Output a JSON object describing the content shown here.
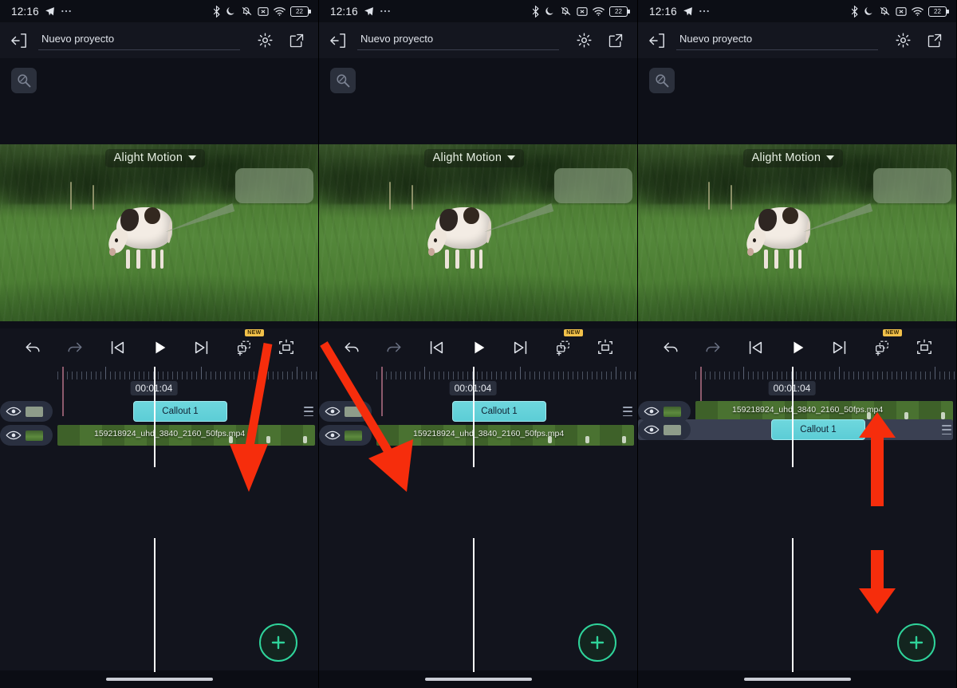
{
  "status_bar": {
    "time": "12:16",
    "left_icons": [
      "telegram-send-icon",
      "more-dots-icon"
    ],
    "right_icons": [
      "bluetooth-icon",
      "do-not-disturb-moon-icon",
      "bell-muted-icon",
      "x-box-icon",
      "wifi-icon"
    ],
    "battery_level": "22"
  },
  "header": {
    "back_label": "back-arrow",
    "project_name": "Nuevo proyecto",
    "settings_label": "settings",
    "export_label": "export"
  },
  "stage": {
    "zoom_button_label": "zoom",
    "watermark": "Alight Motion",
    "watermark_caret": "▾",
    "callout_shape_label": "callout bubble"
  },
  "toolbar": {
    "buttons": [
      {
        "name": "undo-button",
        "label": "undo"
      },
      {
        "name": "redo-button",
        "label": "redo"
      },
      {
        "name": "skip-to-start-button",
        "label": "skip to start"
      },
      {
        "name": "play-button",
        "label": "play"
      },
      {
        "name": "skip-to-end-button",
        "label": "skip to end"
      },
      {
        "name": "add-layer-button",
        "label": "add layer",
        "badge": "NEW"
      },
      {
        "name": "fit-to-screen-button",
        "label": "fit to screen"
      }
    ]
  },
  "timeline": {
    "timecode": "00:01:04",
    "callout_clip_label": "Callout 1",
    "video_clip_filename": "159218924_uhd_3840_2160_50fps.mp4",
    "layer_menu_label": "layer options"
  },
  "fab": {
    "label": "+"
  },
  "colors": {
    "accent_teal": "#2fd39a",
    "clip_cyan": "#5ccdd6",
    "arrow_red": "#f62d0c",
    "badge_yellow": "#f2c14a",
    "panel_bg": "#12141d",
    "layer_ctl_bg": "#2a3040"
  },
  "panels": [
    {
      "id": "panel-1",
      "layer_order": [
        "callout",
        "video"
      ],
      "annotations": [
        {
          "type": "arrow-down-right",
          "name": "annotation-arrow-to-layer-handle"
        }
      ]
    },
    {
      "id": "panel-2",
      "layer_order": [
        "callout",
        "video"
      ],
      "annotations": [
        {
          "type": "arrow-down-right",
          "name": "annotation-arrow-to-visibility-toggle"
        }
      ]
    },
    {
      "id": "panel-3",
      "layer_order": [
        "video",
        "callout"
      ],
      "annotations": [
        {
          "type": "arrow-up",
          "name": "annotation-arrow-move-layer-up"
        },
        {
          "type": "arrow-down",
          "name": "annotation-arrow-move-layer-down"
        }
      ]
    }
  ]
}
